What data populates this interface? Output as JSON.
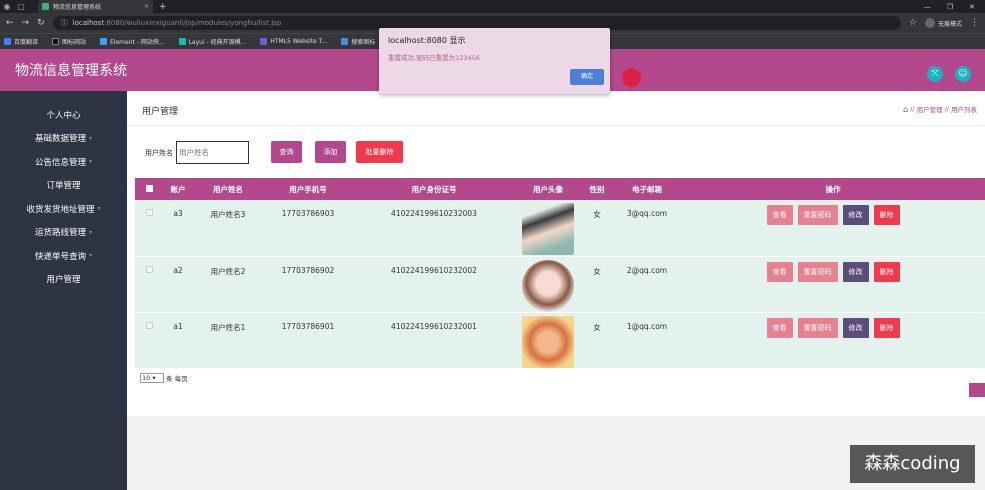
{
  "browser": {
    "tab_title": "物流信息管理系统",
    "url_host": "localhost",
    "url_rest": ":8080/wuliuxinxiguanli/jsp/modules/yonghu/list.jsp",
    "profile_label": "无痕模式",
    "bookmarks": [
      "百度翻译",
      "图标网站",
      "Element - 网站快...",
      "Layui - 经典开源模...",
      "HTML5 Website T...",
      "搜索图标"
    ]
  },
  "app": {
    "title": "物流信息管理系统"
  },
  "sidebar": {
    "items": [
      {
        "label": "个人中心",
        "caret": false
      },
      {
        "label": "基础数据管理",
        "caret": true
      },
      {
        "label": "公告信息管理",
        "caret": true
      },
      {
        "label": "订单管理",
        "caret": false
      },
      {
        "label": "收货发货地址管理",
        "caret": true
      },
      {
        "label": "运货路线管理",
        "caret": true
      },
      {
        "label": "快递单号查询",
        "caret": true
      },
      {
        "label": "用户管理",
        "caret": false
      }
    ]
  },
  "page": {
    "title": "用户管理",
    "breadcrumb": [
      "用户管理",
      "用户列表"
    ]
  },
  "search": {
    "label": "用户姓名",
    "placeholder": "用户姓名",
    "query_btn": "查询",
    "add_btn": "添加",
    "batch_delete_btn": "批量删除"
  },
  "table": {
    "headers": [
      "账户",
      "用户姓名",
      "用户手机号",
      "用户身份证号",
      "用户头像",
      "性别",
      "电子邮箱",
      "操作"
    ],
    "ops": {
      "view": "查看",
      "reset": "重置密码",
      "edit": "修改",
      "delete": "删除"
    },
    "rows": [
      {
        "account": "a3",
        "name": "用户姓名3",
        "phone": "17703786903",
        "idcard": "410224199610232003",
        "gender": "女",
        "email": "3@qq.com"
      },
      {
        "account": "a2",
        "name": "用户姓名2",
        "phone": "17703786902",
        "idcard": "410224199610232002",
        "gender": "女",
        "email": "2@qq.com"
      },
      {
        "account": "a1",
        "name": "用户姓名1",
        "phone": "17703786901",
        "idcard": "410224199610232001",
        "gender": "女",
        "email": "1@qq.com"
      }
    ]
  },
  "pager": {
    "page_size": "10",
    "suffix": "条 每页"
  },
  "dialog": {
    "title": "localhost:8080 显示",
    "message": "重置成功,密码已重置为123456",
    "ok": "确定"
  },
  "watermark": "森森coding",
  "colors": {
    "accent": "#b3488c",
    "sidebar": "#2d3542",
    "row": "#e4f2ed",
    "teal": "#17b2c4",
    "btn_view": "#e8818f",
    "btn_edit": "#5d4d7a",
    "btn_delete": "#f23a4f"
  }
}
